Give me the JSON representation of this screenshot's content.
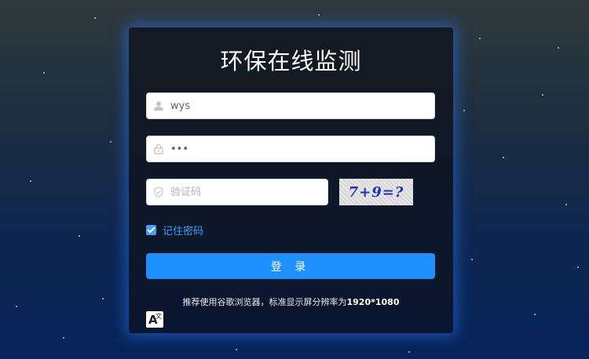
{
  "app": {
    "title": "环保在线监测"
  },
  "form": {
    "username": {
      "value": "wys",
      "icon": "user-icon"
    },
    "password": {
      "value": "•••",
      "icon": "lock-icon"
    },
    "captcha": {
      "placeholder": "验证码",
      "icon": "shield-check-icon",
      "image_text": "7+9=?"
    },
    "remember": {
      "label": "记住密码",
      "checked": true
    },
    "submit_label": "登 录"
  },
  "footer": {
    "tip_prefix": "推荐使用谷歌浏览器，标准显示屏分辨率为",
    "tip_resolution": "1920*1080",
    "language_icon": "translate-icon",
    "language_glyph_a": "A",
    "language_glyph_zh": "文"
  },
  "colors": {
    "accent": "#409eff",
    "button": "#1e90ff",
    "card_glow": "#2878ff"
  }
}
